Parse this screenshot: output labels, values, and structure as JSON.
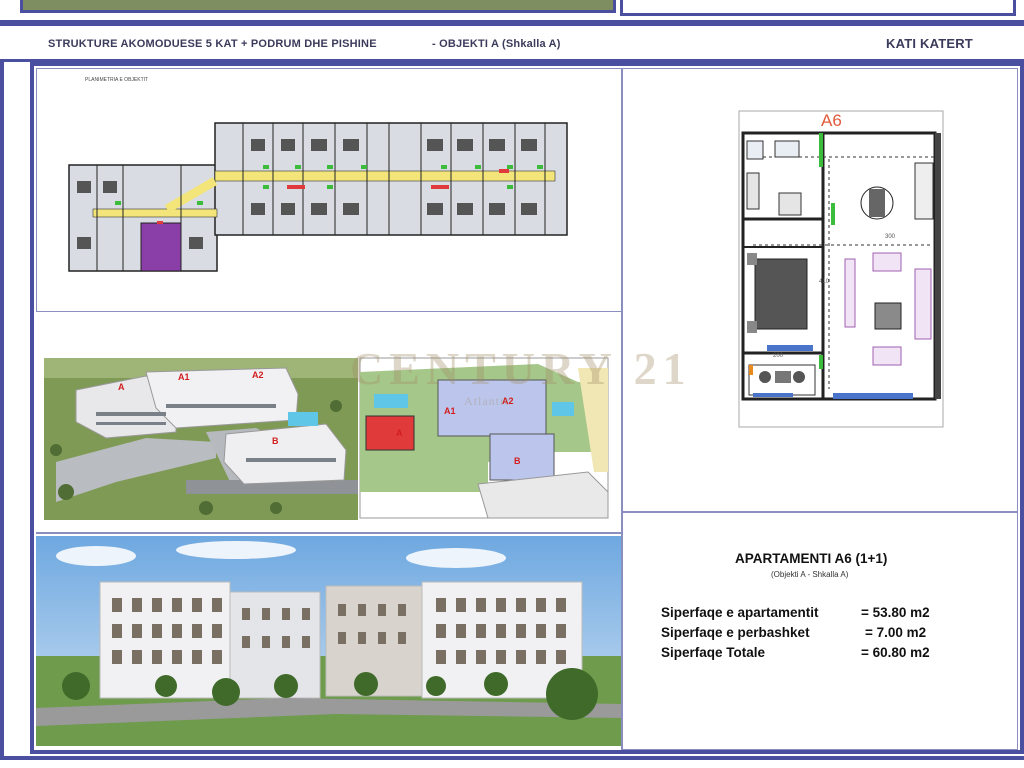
{
  "header": {
    "title": "STRUKTURE AKOMODUESE 5 KAT + PODRUM DHE PISHINE",
    "object": "- OBJEKTI A (Shkalla A)",
    "floor": "KATI KATERT"
  },
  "floorplan": {
    "label": "PLANIMETRIA E OBJEKTIT"
  },
  "aerial": {
    "labels": [
      "A",
      "A1",
      "A2",
      "B"
    ]
  },
  "siteplan": {
    "labels": [
      "A1",
      "A2",
      "A",
      "B"
    ]
  },
  "unit_plan": {
    "title": "A6",
    "dims": [
      "300",
      "410",
      "200"
    ]
  },
  "watermark": {
    "brand": "CENTURY 21",
    "office": "Atlantic"
  },
  "apartment": {
    "title": "APARTAMENTI A6 (1+1)",
    "subtitle": "(Objekti A - Shkalla A)",
    "rows": [
      {
        "label": "Siperfaqe e apartamentit",
        "value": "= 53.80 m2"
      },
      {
        "label": "Siperfaqe e perbashket",
        "value": "= 7.00 m2"
      },
      {
        "label": "Siperfaqe Totale",
        "value": "= 60.80 m2"
      }
    ]
  },
  "colors": {
    "frame": "#4a4fa0",
    "corridor": "#f3e57a",
    "stair": "#8a3fa8",
    "highlight": "#e03a3a"
  }
}
